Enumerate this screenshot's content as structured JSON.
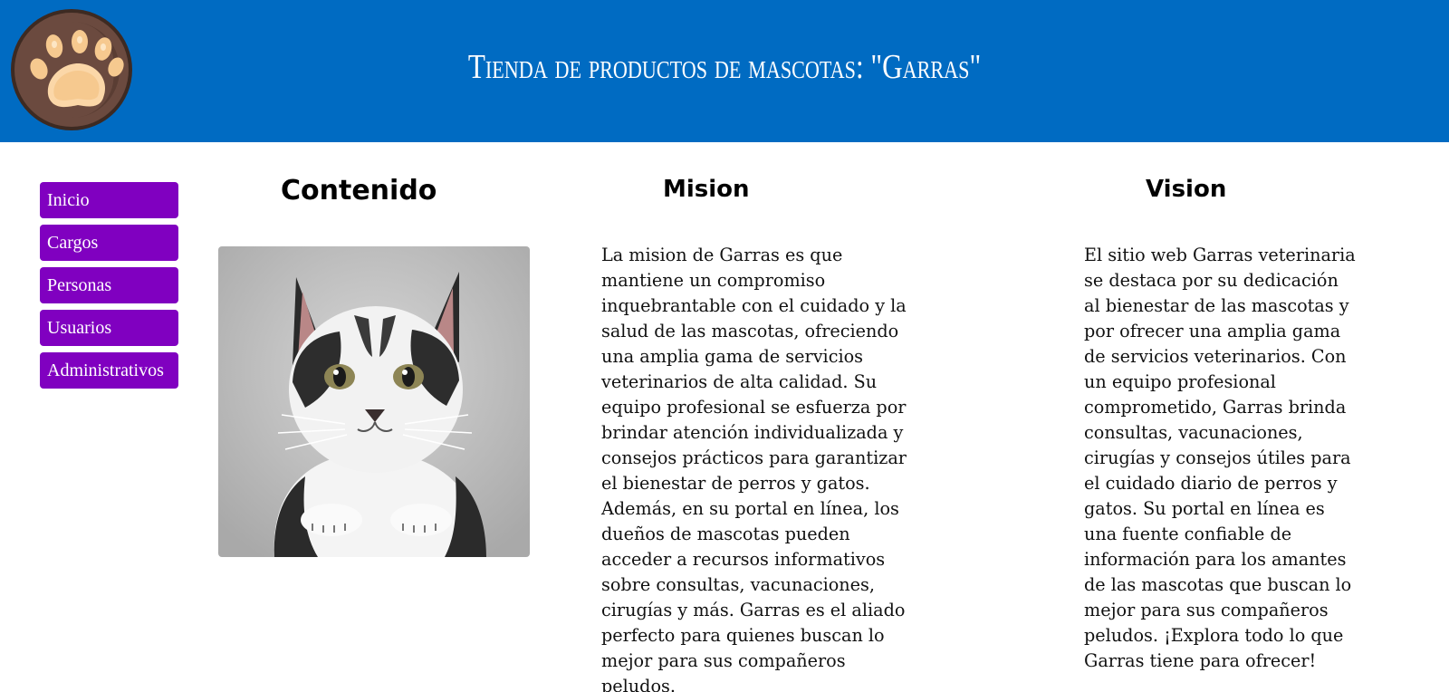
{
  "header": {
    "title": "Tienda de productos de mascotas: \"Garras\"",
    "logo_icon": "paw-icon",
    "background_color": "#006bc2"
  },
  "nav": {
    "items": [
      {
        "label": "Inicio"
      },
      {
        "label": "Cargos"
      },
      {
        "label": "Personas"
      },
      {
        "label": "Usuarios"
      },
      {
        "label": "Administrativos"
      }
    ],
    "item_color": "#8000c0"
  },
  "content": {
    "heading": "Contenido",
    "image_icon": "cat-photo"
  },
  "mision": {
    "heading": "Mision",
    "text": "La mision de Garras es que\nmantiene un compromiso\ninquebrantable con el cuidado y la\nsalud de las mascotas, ofreciendo\nuna amplia gama de servicios\nveterinarios de alta calidad. Su\nequipo profesional se esfuerza por\nbrindar atención individualizada y\nconsejos prácticos para garantizar\nel bienestar de perros y gatos.\nAdemás, en su portal en línea, los\ndueños de mascotas pueden\nacceder a recursos informativos\nsobre consultas, vacunaciones,\ncirugías y más. Garras es el aliado\nperfecto para quienes buscan lo\nmejor para sus compañeros\npeludos."
  },
  "vision": {
    "heading": "Vision",
    "text": "El sitio web Garras veterinaria\nse destaca por su dedicación\nal bienestar de las mascotas y\npor ofrecer una amplia gama\nde servicios veterinarios. Con\nun equipo profesional\ncomprometido, Garras brinda\nconsultas, vacunaciones,\ncirugías y consejos útiles para\nel cuidado diario de perros y\ngatos. Su portal en línea es\nuna fuente confiable de\ninformación para los amantes\nde las mascotas que buscan lo\nmejor para sus compañeros\npeludos. ¡Explora todo lo que\nGarras tiene para ofrecer!"
  }
}
